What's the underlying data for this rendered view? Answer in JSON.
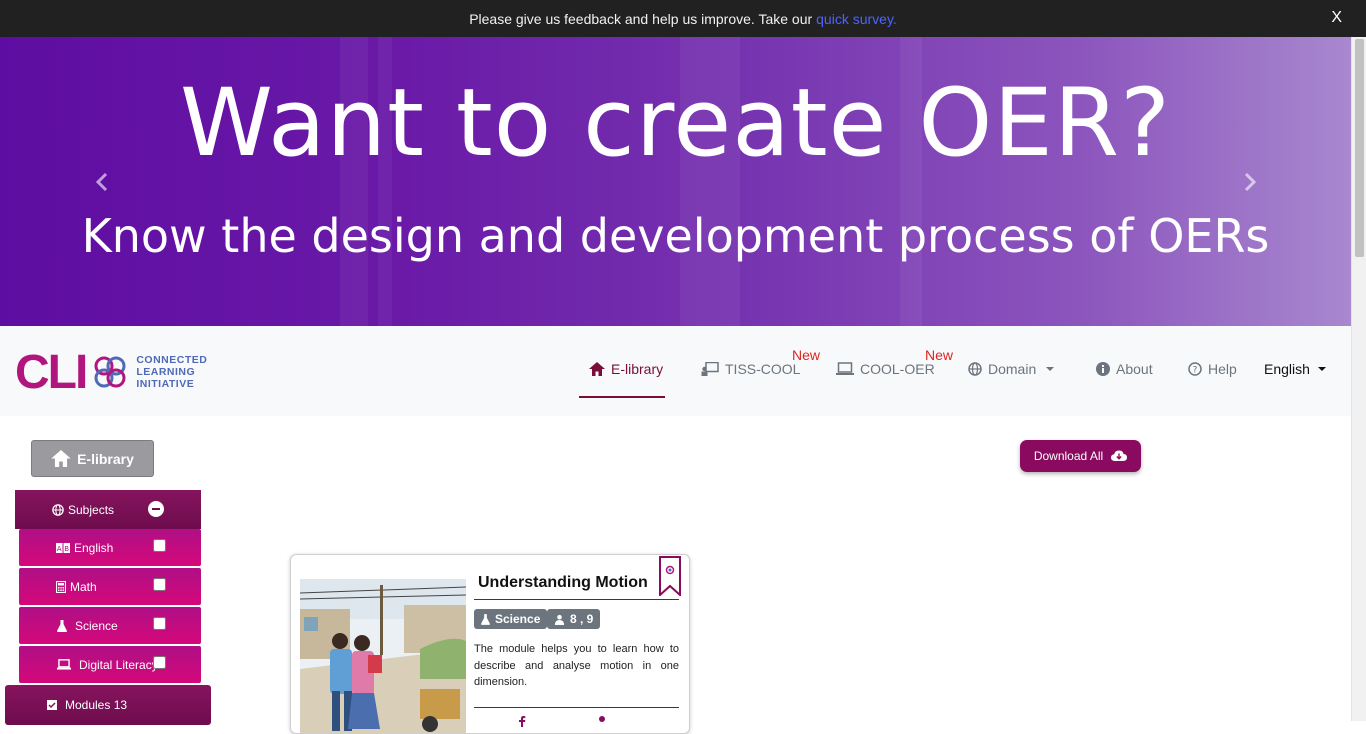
{
  "feedback": {
    "text": "Please give us feedback and help us improve. Take our",
    "link": "quick survey.",
    "close": "X"
  },
  "banner": {
    "headline": "Want to create OER?",
    "subline": "Know the design and development process of OERs",
    "prev_icon": "chevron-left-icon",
    "next_icon": "chevron-right-icon"
  },
  "logo": {
    "text": "CLI",
    "line1": "CONNECTED",
    "line2": "LEARNING",
    "line3": "INITIATIVE"
  },
  "nav": {
    "elibrary": "E-library",
    "tiss_cool": "TISS-COOL",
    "cool_oer": "COOL-OER",
    "domain": "Domain",
    "about": "About",
    "help": "Help",
    "language": "English",
    "new_badge": "New"
  },
  "sidebar": {
    "elibrary_button": "E-library",
    "subjects": "Subjects",
    "items": [
      {
        "label": "English",
        "icon": "language-icon",
        "checked": false
      },
      {
        "label": "Math",
        "icon": "calculator-icon",
        "checked": false
      },
      {
        "label": "Science",
        "icon": "flask-icon",
        "checked": false
      },
      {
        "label": "Digital Literacy",
        "icon": "laptop-icon",
        "checked": false
      }
    ],
    "modules": "Modules 13"
  },
  "download": {
    "label": "Download All",
    "icon": "cloud-download-icon"
  },
  "card": {
    "title": "Understanding Motion",
    "subject_tag": "Science",
    "grade_tag": "8 , 9",
    "description": "The module helps you to learn how to describe and analyse motion in one dimension."
  },
  "colors": {
    "brand": "#8a0a5f",
    "subject_button": "#c40c80",
    "banner_start": "#5e0da2",
    "banner_end": "#a888cf",
    "new_badge": "#e0241f"
  }
}
